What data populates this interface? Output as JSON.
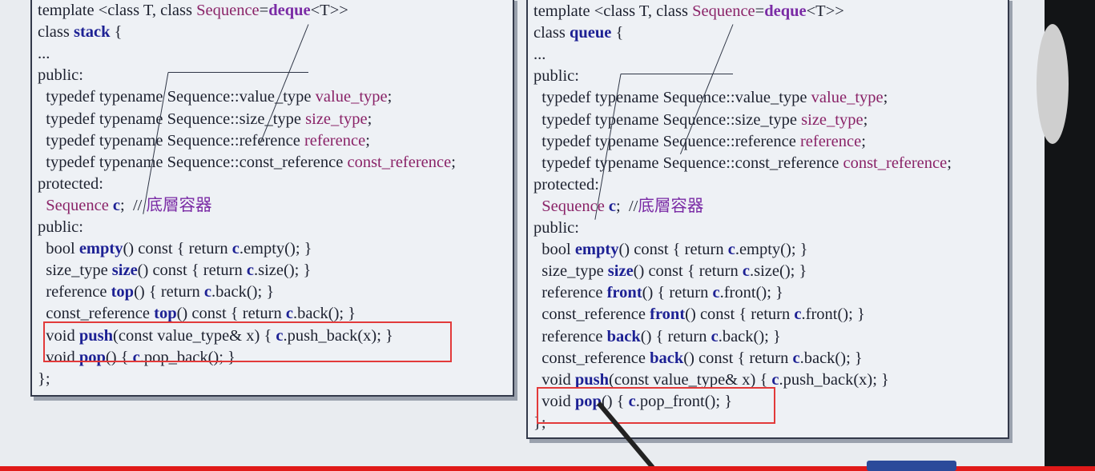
{
  "stack": {
    "lines": [
      [
        {
          "t": "template <class T, class "
        },
        {
          "t": "Sequence",
          "c": "ty"
        },
        {
          "t": "="
        },
        {
          "t": "deque",
          "c": "pu",
          "b": true
        },
        {
          "t": "<T>>"
        }
      ],
      [
        {
          "t": "class "
        },
        {
          "t": "stack",
          "c": "kw"
        },
        {
          "t": " {"
        }
      ],
      [
        {
          "t": "..."
        }
      ],
      [
        {
          "t": "public:"
        }
      ],
      [
        {
          "t": "  typedef typename Sequence::value_type "
        },
        {
          "t": "value_type",
          "c": "ty"
        },
        {
          "t": ";"
        }
      ],
      [
        {
          "t": "  typedef typename Sequence::size_type "
        },
        {
          "t": "size_type",
          "c": "ty"
        },
        {
          "t": ";"
        }
      ],
      [
        {
          "t": "  typedef typename Sequence::reference "
        },
        {
          "t": "reference",
          "c": "ty"
        },
        {
          "t": ";"
        }
      ],
      [
        {
          "t": "  typedef typename Sequence::const_reference "
        },
        {
          "t": "const_reference",
          "c": "ty"
        },
        {
          "t": ";"
        }
      ],
      [
        {
          "t": "protected:"
        }
      ],
      [
        {
          "t": "  "
        },
        {
          "t": "Sequence",
          "c": "ty"
        },
        {
          "t": " "
        },
        {
          "t": "c",
          "c": "kw"
        },
        {
          "t": ";  // "
        },
        {
          "t": "底層容器",
          "c": "cn"
        }
      ],
      [
        {
          "t": "public:"
        }
      ],
      [
        {
          "t": "  bool "
        },
        {
          "t": "empty",
          "c": "kw"
        },
        {
          "t": "() const { return "
        },
        {
          "t": "c",
          "c": "kw"
        },
        {
          "t": ".empty(); }"
        }
      ],
      [
        {
          "t": "  size_type "
        },
        {
          "t": "size",
          "c": "kw"
        },
        {
          "t": "() const { return "
        },
        {
          "t": "c",
          "c": "kw"
        },
        {
          "t": ".size(); }"
        }
      ],
      [
        {
          "t": "  reference "
        },
        {
          "t": "top",
          "c": "kw"
        },
        {
          "t": "() { return "
        },
        {
          "t": "c",
          "c": "kw"
        },
        {
          "t": ".back(); }"
        }
      ],
      [
        {
          "t": "  const_reference "
        },
        {
          "t": "top",
          "c": "kw"
        },
        {
          "t": "() const { return "
        },
        {
          "t": "c",
          "c": "kw"
        },
        {
          "t": ".back(); }"
        }
      ],
      [
        {
          "t": "  void "
        },
        {
          "t": "push",
          "c": "kw"
        },
        {
          "t": "(const value_type& x) { "
        },
        {
          "t": "c",
          "c": "kw"
        },
        {
          "t": ".push_back(x); }"
        }
      ],
      [
        {
          "t": "  void "
        },
        {
          "t": "pop",
          "c": "kw"
        },
        {
          "t": "() { "
        },
        {
          "t": "c",
          "c": "kw"
        },
        {
          "t": ".pop_back(); }"
        }
      ],
      [
        {
          "t": "};"
        }
      ]
    ]
  },
  "queue": {
    "lines": [
      [
        {
          "t": "template <class T, class "
        },
        {
          "t": "Sequence",
          "c": "ty"
        },
        {
          "t": "="
        },
        {
          "t": "deque",
          "c": "pu",
          "b": true
        },
        {
          "t": "<T>>"
        }
      ],
      [
        {
          "t": "class "
        },
        {
          "t": "queue",
          "c": "kw"
        },
        {
          "t": " {"
        }
      ],
      [
        {
          "t": "..."
        }
      ],
      [
        {
          "t": "public:"
        }
      ],
      [
        {
          "t": "  typedef typename Sequence::value_type "
        },
        {
          "t": "value_type",
          "c": "ty"
        },
        {
          "t": ";"
        }
      ],
      [
        {
          "t": "  typedef typename Sequence::size_type "
        },
        {
          "t": "size_type",
          "c": "ty"
        },
        {
          "t": ";"
        }
      ],
      [
        {
          "t": "  typedef typename Sequence::reference "
        },
        {
          "t": "reference",
          "c": "ty"
        },
        {
          "t": ";"
        }
      ],
      [
        {
          "t": "  typedef typename Sequence::const_reference "
        },
        {
          "t": "const_reference",
          "c": "ty"
        },
        {
          "t": ";"
        }
      ],
      [
        {
          "t": "protected:"
        }
      ],
      [
        {
          "t": "  "
        },
        {
          "t": "Sequence",
          "c": "ty"
        },
        {
          "t": " "
        },
        {
          "t": "c",
          "c": "kw"
        },
        {
          "t": ";  //"
        },
        {
          "t": "底層容器",
          "c": "cn"
        }
      ],
      [
        {
          "t": "public:"
        }
      ],
      [
        {
          "t": "  bool "
        },
        {
          "t": "empty",
          "c": "kw"
        },
        {
          "t": "() const { return "
        },
        {
          "t": "c",
          "c": "kw"
        },
        {
          "t": ".empty(); }"
        }
      ],
      [
        {
          "t": "  size_type "
        },
        {
          "t": "size",
          "c": "kw"
        },
        {
          "t": "() const { return "
        },
        {
          "t": "c",
          "c": "kw"
        },
        {
          "t": ".size(); }"
        }
      ],
      [
        {
          "t": "  reference "
        },
        {
          "t": "front",
          "c": "kw"
        },
        {
          "t": "() { return "
        },
        {
          "t": "c",
          "c": "kw"
        },
        {
          "t": ".front(); }"
        }
      ],
      [
        {
          "t": "  const_reference "
        },
        {
          "t": "front",
          "c": "kw"
        },
        {
          "t": "() const { return "
        },
        {
          "t": "c",
          "c": "kw"
        },
        {
          "t": ".front(); }"
        }
      ],
      [
        {
          "t": "  reference "
        },
        {
          "t": "back",
          "c": "kw"
        },
        {
          "t": "() { return "
        },
        {
          "t": "c",
          "c": "kw"
        },
        {
          "t": ".back(); }"
        }
      ],
      [
        {
          "t": "  const_reference "
        },
        {
          "t": "back",
          "c": "kw"
        },
        {
          "t": "() const { return "
        },
        {
          "t": "c",
          "c": "kw"
        },
        {
          "t": ".back(); }"
        }
      ],
      [
        {
          "t": "  void "
        },
        {
          "t": "push",
          "c": "kw"
        },
        {
          "t": "(const value_type& x) { "
        },
        {
          "t": "c",
          "c": "kw"
        },
        {
          "t": ".push_back(x); }"
        }
      ],
      [
        {
          "t": "  void "
        },
        {
          "t": "pop",
          "c": "kw"
        },
        {
          "t": "() { "
        },
        {
          "t": "c",
          "c": "kw"
        },
        {
          "t": ".pop_front(); }"
        }
      ],
      [
        {
          "t": "};"
        }
      ]
    ]
  },
  "highlights": [
    "stack-push",
    "queue-pop"
  ],
  "video": {
    "progress": 1.0
  }
}
